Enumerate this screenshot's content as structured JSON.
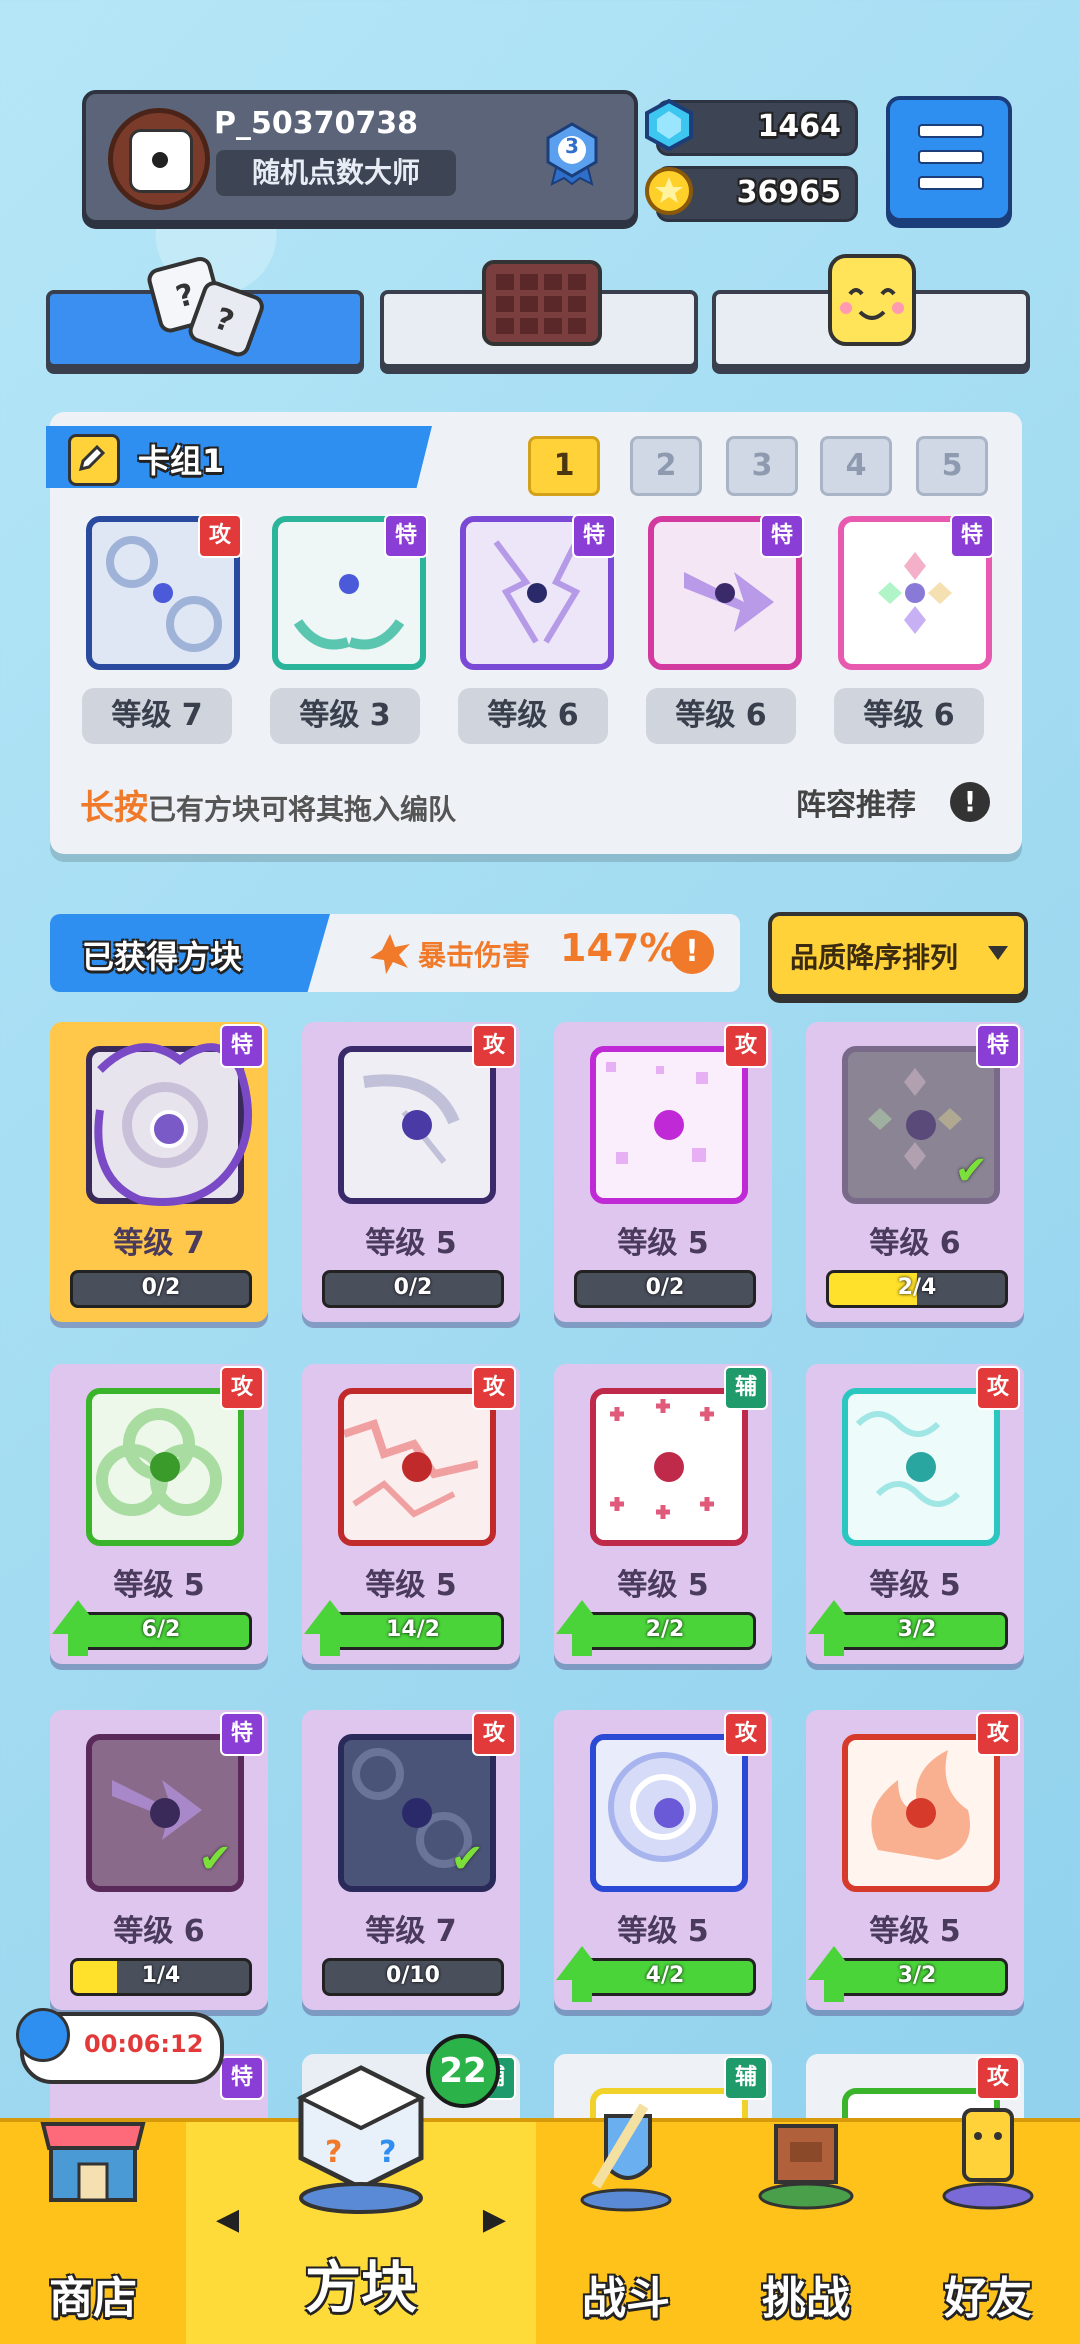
{
  "player": {
    "id": "P_50370738",
    "title": "随机点数大师",
    "rank": "3"
  },
  "currency": {
    "gems": "1464",
    "coins": "36965"
  },
  "deck": {
    "name": "卡组1",
    "tabs": [
      "1",
      "2",
      "3",
      "4",
      "5"
    ],
    "active_tab": "1",
    "cards": [
      {
        "badge": "攻",
        "level": "等级 7"
      },
      {
        "badge": "特",
        "level": "等级 3"
      },
      {
        "badge": "特",
        "level": "等级 6"
      },
      {
        "badge": "特",
        "level": "等级 6"
      },
      {
        "badge": "特",
        "level": "等级 6"
      }
    ],
    "hint_em": "长按",
    "hint_rest": "已有方块可将其拖入编队",
    "recommend": "阵容推荐",
    "recommend_icon": "!"
  },
  "owned": {
    "title": "已获得方块",
    "crit_label": "暴击伤害",
    "crit_value": "147%",
    "crit_icon": "!",
    "sort_label": "品质降序排列",
    "cards": [
      {
        "badge": "特",
        "level": "等级 7",
        "progress": "0/2",
        "fill": 0,
        "up": false
      },
      {
        "badge": "攻",
        "level": "等级 5",
        "progress": "0/2",
        "fill": 0,
        "up": false
      },
      {
        "badge": "攻",
        "level": "等级 5",
        "progress": "0/2",
        "fill": 0,
        "up": false
      },
      {
        "badge": "特",
        "level": "等级 6",
        "progress": "2/4",
        "fill": 0.5,
        "up": false,
        "check": "✔"
      },
      {
        "badge": "攻",
        "level": "等级 5",
        "progress": "6/2",
        "fill": 1,
        "up": true
      },
      {
        "badge": "攻",
        "level": "等级 5",
        "progress": "14/2",
        "fill": 1,
        "up": true
      },
      {
        "badge": "辅",
        "level": "等级 5",
        "progress": "2/2",
        "fill": 1,
        "up": true
      },
      {
        "badge": "攻",
        "level": "等级 5",
        "progress": "3/2",
        "fill": 1,
        "up": true
      },
      {
        "badge": "特",
        "level": "等级 6",
        "progress": "1/4",
        "fill": 0.25,
        "up": false,
        "check": "✔"
      },
      {
        "badge": "攻",
        "level": "等级 7",
        "progress": "0/10",
        "fill": 0,
        "up": false,
        "check": "✔"
      },
      {
        "badge": "攻",
        "level": "等级 5",
        "progress": "4/2",
        "fill": 1,
        "up": true
      },
      {
        "badge": "攻",
        "level": "等级 5",
        "progress": "3/2",
        "fill": 1,
        "up": true
      }
    ],
    "partial_badges": [
      "特",
      "辅",
      "辅",
      "攻"
    ]
  },
  "timer": "00:06:12",
  "nav": {
    "shop": "商店",
    "blocks": "方块",
    "blocks_count": "22",
    "battle": "战斗",
    "challenge": "挑战",
    "friends": "好友",
    "arrow_left": "◀",
    "arrow_right": "▶"
  },
  "colors": {
    "accent_blue": "#2f8ff0",
    "gold": "#ffc21a",
    "attack_red": "#e23a3a",
    "special_purple": "#8a3ed6",
    "support_green": "#1f9a6a"
  }
}
